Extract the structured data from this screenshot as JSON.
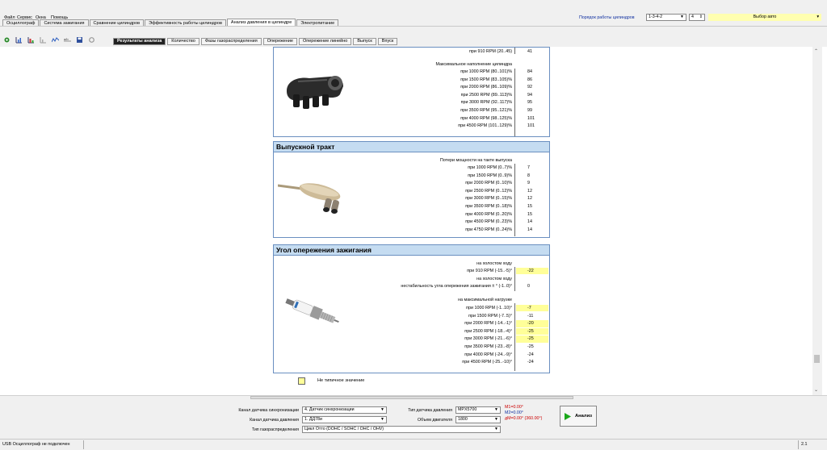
{
  "menu": [
    "Файл",
    "Сервис",
    "Окна",
    "Помощь"
  ],
  "top_right": {
    "order_label": "Порядок работы цилиндров",
    "order_value": "1-3-4-2",
    "cyl_count": "4",
    "auto_select": "Выбор авто"
  },
  "tabs": [
    "Осциллограф",
    "Система зажигания",
    "Сравнение цилиндров",
    "Эффективность работы цилиндров",
    "Анализ давления в цилиндре",
    "Электропитание"
  ],
  "subtabs": [
    "Результаты анализа",
    "Количество",
    "Фазы газораспределения",
    "Опережение",
    "Опережение линейно",
    "Выпуск",
    "Впуск"
  ],
  "intake": {
    "top_row": {
      "label": "при 910 RPM (20..45)",
      "value": "41"
    },
    "heading": "Максимальное наполнение цилиндра",
    "rows": [
      {
        "label": "при 1000 RPM (80..101)%",
        "value": "84"
      },
      {
        "label": "при 1500 RPM (83..105)%",
        "value": "86"
      },
      {
        "label": "при 2000 RPM (86..109)%",
        "value": "92"
      },
      {
        "label": "при 2500 RPM (89..113)%",
        "value": "94"
      },
      {
        "label": "при 3000 RPM (92..117)%",
        "value": "95"
      },
      {
        "label": "при 3500 RPM (95..121)%",
        "value": "99"
      },
      {
        "label": "при 4000 RPM (98..125)%",
        "value": "101"
      },
      {
        "label": "при 4500 RPM (101..129)%",
        "value": "101"
      }
    ]
  },
  "exhaust": {
    "title": "Выпускной тракт",
    "heading": "Потери мощности на такте выпуска",
    "rows": [
      {
        "label": "при 1000 RPM (0..7)%",
        "value": "7"
      },
      {
        "label": "при 1500 RPM (0..9)%",
        "value": "8"
      },
      {
        "label": "при 2000 RPM (0..10)%",
        "value": "9"
      },
      {
        "label": "при 2500 RPM (0..12)%",
        "value": "12"
      },
      {
        "label": "при 3000 RPM (0..15)%",
        "value": "12"
      },
      {
        "label": "при 3500 RPM (0..18)%",
        "value": "15"
      },
      {
        "label": "при 4000 RPM (0..20)%",
        "value": "15"
      },
      {
        "label": "при 4500 RPM (0..23)%",
        "value": "14"
      },
      {
        "label": "при 4750 RPM (0..24)%",
        "value": "14"
      }
    ]
  },
  "ignition": {
    "title": "Угол опережения зажигания",
    "idle_heading": "на холостом ходу",
    "idle_row": {
      "label": "при 910 RPM (-15..-5)°",
      "value": "-22"
    },
    "instab_heading": "на холостом ходу",
    "instab_row": {
      "label": "нестабильность угла опережения зажигания ± ° (-1..0)°",
      "value": "0"
    },
    "load_heading": "на максимальной нагрузке",
    "rows": [
      {
        "label": "при 1000 RPM (-1..10)°",
        "value": "-7",
        "hl": true
      },
      {
        "label": "при 1500 RPM (-7..5)°",
        "value": "-11",
        "hl": false
      },
      {
        "label": "при 2000 RPM (-14..-1)°",
        "value": "-20",
        "hl": true
      },
      {
        "label": "при 2500 RPM (-18..-4)°",
        "value": "-25",
        "hl": true
      },
      {
        "label": "при 3000 RPM (-21..-6)°",
        "value": "-25",
        "hl": true
      },
      {
        "label": "при 3500 RPM (-23..-8)°",
        "value": "-25",
        "hl": false
      },
      {
        "label": "при 4000 RPM (-24..-9)°",
        "value": "-24",
        "hl": false
      },
      {
        "label": "при 4500 RPM (-25..-10)°",
        "value": "-24",
        "hl": false
      }
    ]
  },
  "legend": {
    "text": "Не типичное значение",
    "color": "#ffff99"
  },
  "bottom": {
    "sync_label": "Канал датчика синхронизации",
    "sync_value": "4. Датчик синхронизации",
    "pressure_label": "Канал датчика давления",
    "pressure_value": "1. ДД78и",
    "timing_label": "Тип газораспределения",
    "timing_value": "Цикл Отто (DOHC / SOHC / OHC / OHV)",
    "sensor_type_label": "Тип датчика давления",
    "sensor_type_value": "MPX5700",
    "volume_label": "Объем двигателя",
    "volume_value": "1800",
    "m1": "M1=0.00°",
    "m2": "M2=0.00°",
    "dm": "дM=0.00° (360.00°)",
    "analyze_label": "Анализ",
    "accent_red": "#cc0000",
    "accent_blue": "#1030a0"
  },
  "status": {
    "left": "USB Осциллограф не подключен",
    "right": "2.1"
  }
}
